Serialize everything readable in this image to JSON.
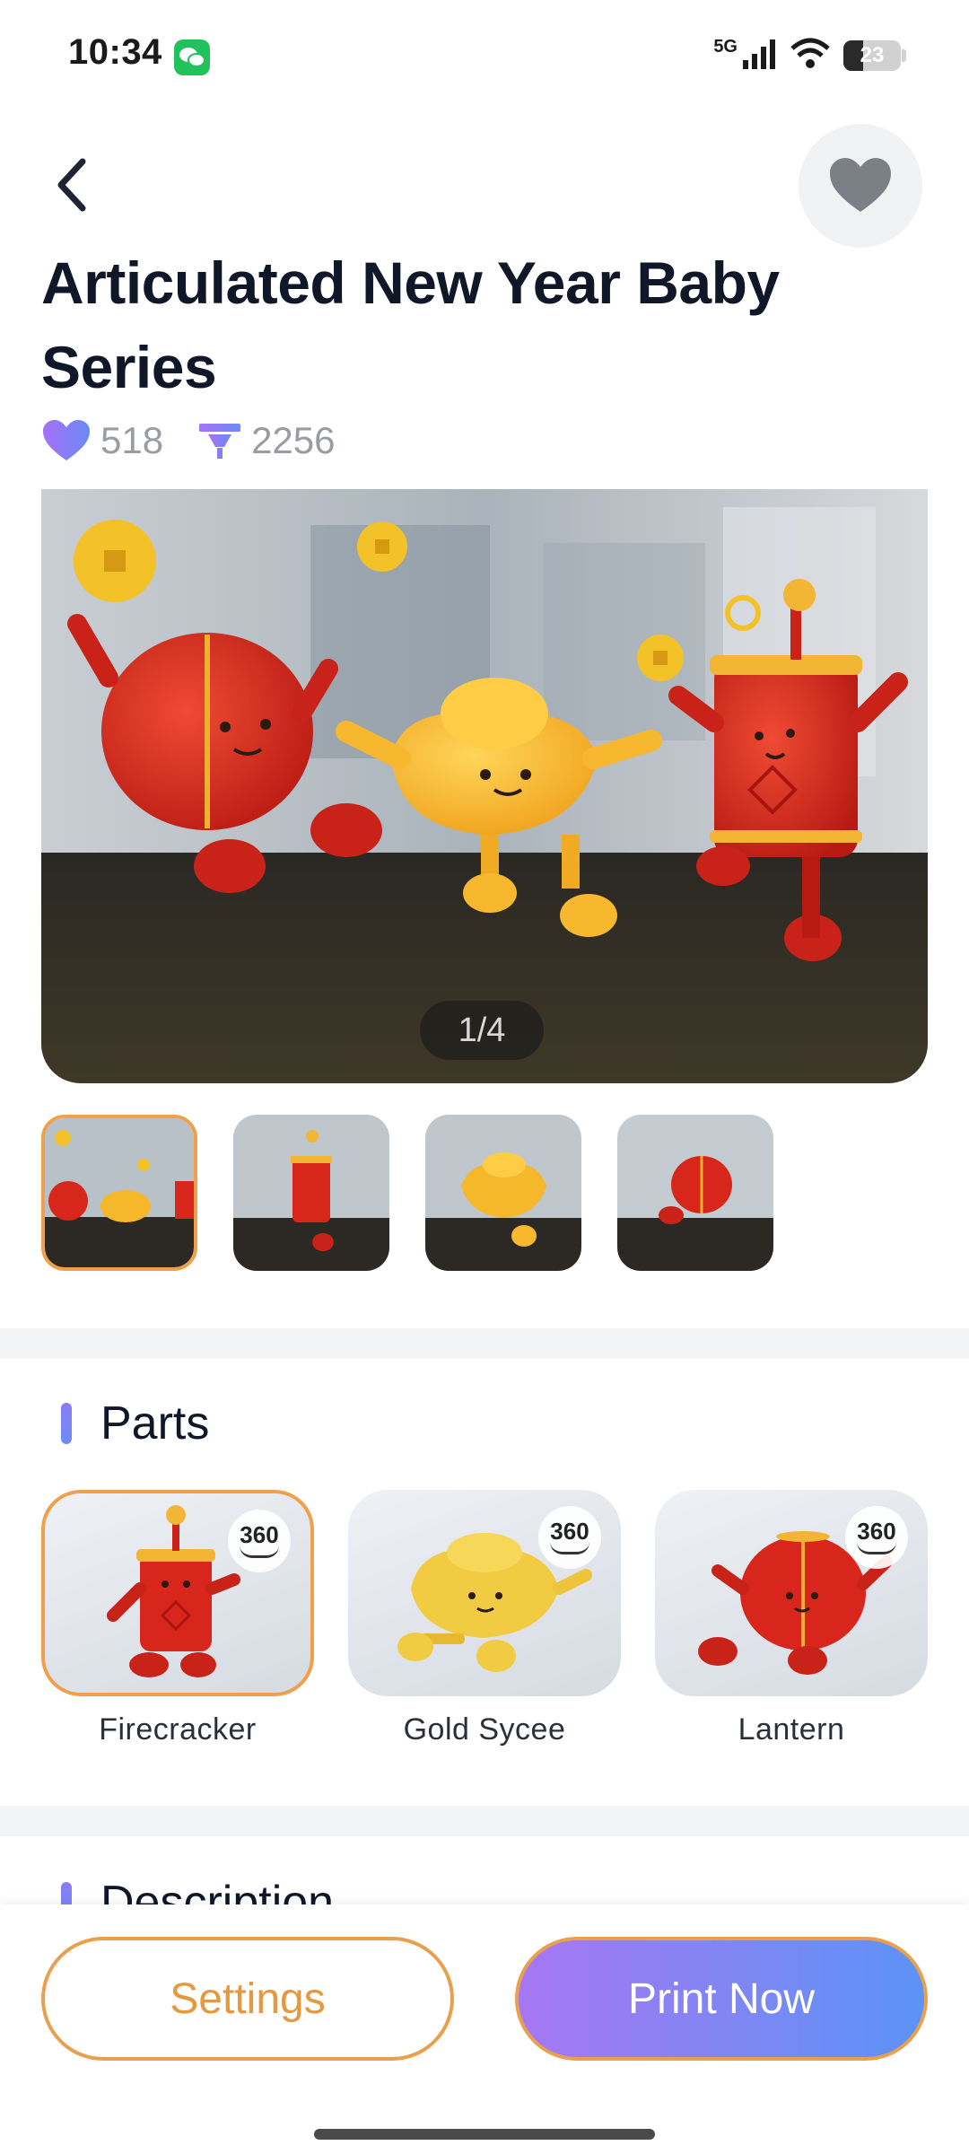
{
  "status_bar": {
    "time": "10:34",
    "network": "5G",
    "battery": "23",
    "icons": [
      "wechat-icon",
      "signal-icon",
      "wifi-icon",
      "battery-icon"
    ]
  },
  "header": {
    "back_icon": "chevron-left-icon",
    "favorite_icon": "heart-icon",
    "title": "Articulated New Year Baby Series",
    "likes": "518",
    "prints": "2256"
  },
  "gallery": {
    "counter": "1/4",
    "thumbnails": [
      "all-three-figures",
      "firecracker",
      "gold-sycee",
      "lantern"
    ],
    "active_index": 0
  },
  "parts": {
    "title": "Parts",
    "badge": "360",
    "items": [
      {
        "label": "Firecracker",
        "active": true
      },
      {
        "label": "Gold Sycee",
        "active": false
      },
      {
        "label": "Lantern",
        "active": false
      }
    ]
  },
  "description": {
    "title": "Description"
  },
  "actions": {
    "settings_label": "Settings",
    "print_label": "Print Now"
  },
  "colors": {
    "accent_orange": "#f0a04b",
    "gradient_start": "#a777f4",
    "gradient_end": "#5c93f5",
    "figure_red": "#d8261c",
    "figure_gold": "#f5b82a"
  }
}
